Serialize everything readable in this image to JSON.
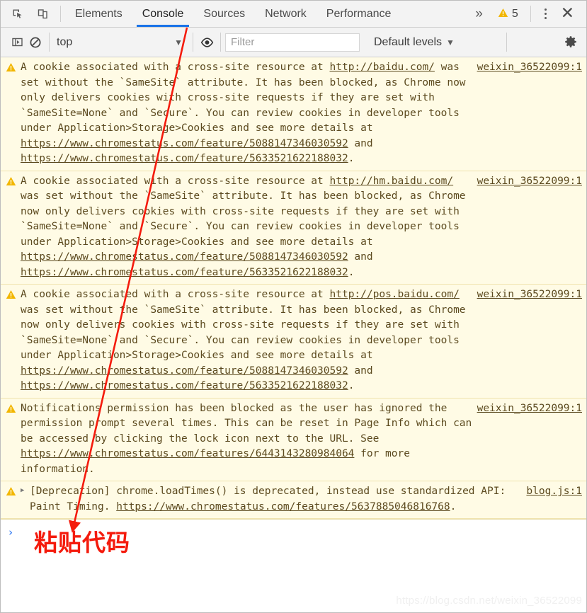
{
  "window": {
    "title": "Chrome DevTools Console"
  },
  "toolbar": {
    "inspect_icon": "inspect-element-icon",
    "device_icon": "device-toolbar-icon",
    "tabs": [
      {
        "label": "Elements",
        "active": false
      },
      {
        "label": "Console",
        "active": true
      },
      {
        "label": "Sources",
        "active": false
      },
      {
        "label": "Network",
        "active": false
      },
      {
        "label": "Performance",
        "active": false
      }
    ],
    "more_tabs_label": "»",
    "warning_icon": "warning-triangle-icon",
    "warning_count": "5",
    "menu_icon": "kebab-menu-icon",
    "close_label": "✕"
  },
  "filterbar": {
    "sidebar_toggle_icon": "console-sidebar-toggle-icon",
    "clear_icon": "clear-console-icon",
    "context_value": "top",
    "context_caret": "▼",
    "eye_icon": "live-expression-eye-icon",
    "filter_placeholder": "Filter",
    "filter_value": "",
    "levels_label": "Default levels",
    "levels_caret": "▼",
    "settings_icon": "settings-gear-icon"
  },
  "console": {
    "messages": [
      {
        "level": "warning",
        "expandable": false,
        "text": "A cookie associated with a cross-site resource at http://baidu.com/ was set without the `SameSite` attribute. It has been blocked, as Chrome now only delivers cookies with cross-site requests if they are set with `SameSite=None` and `Secure`. You can review cookies in developer tools under Application>Storage>Cookies and see more details at https://www.chromestatus.com/feature/5088147346030592 and https://www.chromestatus.com/feature/5633521622188032.",
        "segments": [
          {
            "t": "A cookie associated with a cross-site resource at ",
            "link": false
          },
          {
            "t": "http://baidu.com/",
            "link": true
          },
          {
            "t": " was set without the `SameSite` attribute. It has been blocked, as Chrome now only delivers cookies with cross-site requests if they are set with `SameSite=None` and `Secure`. You can review cookies in developer tools under Application>Storage>Cookies and see more details at ",
            "link": false
          },
          {
            "t": "https://www.chromestatus.com/feature/5088147346030592",
            "link": true
          },
          {
            "t": " and ",
            "link": false
          },
          {
            "t": "https://www.chromestatus.com/feature/5633521622188032",
            "link": true
          },
          {
            "t": ".",
            "link": false
          }
        ],
        "source": "weixin_36522099:1"
      },
      {
        "level": "warning",
        "expandable": false,
        "text": "A cookie associated with a cross-site resource at http://hm.baidu.com/ was set without the `SameSite` attribute. It has been blocked, as Chrome now only delivers cookies with cross-site requests if they are set with `SameSite=None` and `Secure`. You can review cookies in developer tools under Application>Storage>Cookies and see more details at https://www.chromestatus.com/feature/5088147346030592 and https://www.chromestatus.com/feature/5633521622188032.",
        "segments": [
          {
            "t": "A cookie associated with a cross-site resource at ",
            "link": false
          },
          {
            "t": "http://hm.baidu.com/",
            "link": true
          },
          {
            "t": " was set without the `SameSite` attribute. It has been blocked, as Chrome now only delivers cookies with cross-site requests if they are set with `SameSite=None` and `Secure`. You can review cookies in developer tools under Application>Storage>Cookies and see more details at ",
            "link": false
          },
          {
            "t": "https://www.chromestatus.com/feature/5088147346030592",
            "link": true
          },
          {
            "t": " and ",
            "link": false
          },
          {
            "t": "https://www.chromestatus.com/feature/5633521622188032",
            "link": true
          },
          {
            "t": ".",
            "link": false
          }
        ],
        "source": "weixin_36522099:1"
      },
      {
        "level": "warning",
        "expandable": false,
        "text": "A cookie associated with a cross-site resource at http://pos.baidu.com/ was set without the `SameSite` attribute. It has been blocked, as Chrome now only delivers cookies with cross-site requests if they are set with `SameSite=None` and `Secure`. You can review cookies in developer tools under Application>Storage>Cookies and see more details at https://www.chromestatus.com/feature/5088147346030592 and https://www.chromestatus.com/feature/5633521622188032.",
        "segments": [
          {
            "t": "A cookie associated with a cross-site resource at ",
            "link": false
          },
          {
            "t": "http://pos.baidu.com/",
            "link": true
          },
          {
            "t": " was set without the `SameSite` attribute. It has been blocked, as Chrome now only delivers cookies with cross-site requests if they are set with `SameSite=None` and `Secure`. You can review cookies in developer tools under Application>Storage>Cookies and see more details at ",
            "link": false
          },
          {
            "t": "https://www.chromestatus.com/feature/5088147346030592",
            "link": true
          },
          {
            "t": " and ",
            "link": false
          },
          {
            "t": "https://www.chromestatus.com/feature/5633521622188032",
            "link": true
          },
          {
            "t": ".",
            "link": false
          }
        ],
        "source": "weixin_36522099:1"
      },
      {
        "level": "warning",
        "expandable": false,
        "text": "Notifications permission has been blocked as the user has ignored the permission prompt several times. This can be reset in Page Info which can be accessed by clicking the lock icon next to the URL. See https://www.chromestatus.com/features/6443143280984064 for more information.",
        "segments": [
          {
            "t": "Notifications permission has been blocked as the user has ignored the permission prompt several times. This can be reset in Page Info which can be accessed by clicking the lock icon next to the URL. See ",
            "link": false
          },
          {
            "t": "https://www.chromestatus.com/features/6443143280984064",
            "link": true
          },
          {
            "t": " for more information.",
            "link": false
          }
        ],
        "source": "weixin_36522099:1"
      },
      {
        "level": "warning",
        "expandable": true,
        "expand_glyph": "▶",
        "text": "[Deprecation] chrome.loadTimes() is deprecated, instead use standardized API: Paint Timing. https://www.chromestatus.com/features/5637885046816768.",
        "segments": [
          {
            "t": "[Deprecation] chrome.loadTimes() is deprecated, instead use standardized API: Paint Timing. ",
            "link": false
          },
          {
            "t": "https://www.chromestatus.com/features/5637885046816768",
            "link": true
          },
          {
            "t": ".",
            "link": false
          }
        ],
        "source": "blog.js:1"
      }
    ],
    "prompt_chevron": "›",
    "prompt_value": ""
  },
  "annotation": {
    "label": "粘贴代码",
    "color": "#f41b0d"
  },
  "watermark": {
    "text": "https://blog.csdn.net/weixin_36522099"
  },
  "colors": {
    "accent": "#1a73e8",
    "warning_bg": "#fffbe5",
    "warning_border": "#f0e3ae",
    "warning_text": "#5c4a1f",
    "warning_icon": "#f2b600",
    "toolbar_bg": "#f3f3f3",
    "prompt": "#4285f4",
    "annotation_red": "#f41b0d"
  }
}
